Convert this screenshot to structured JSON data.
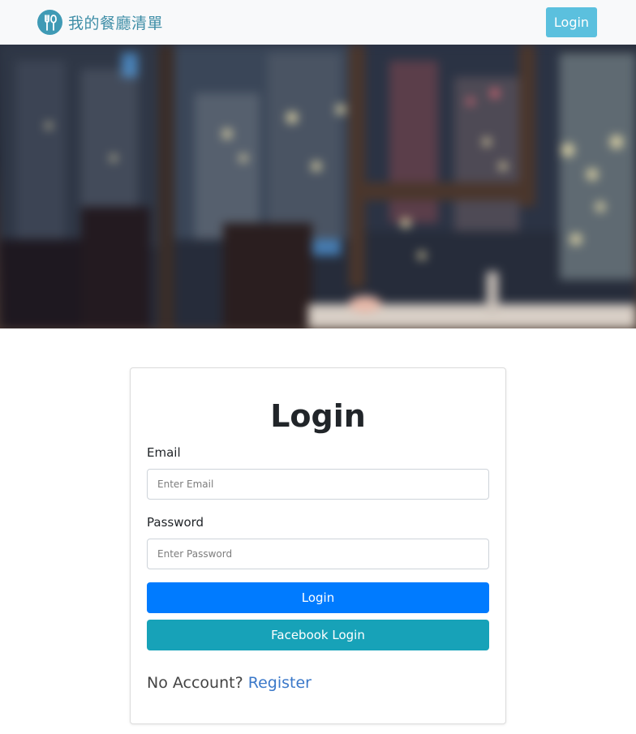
{
  "navbar": {
    "brand_icon": "fork-knife-icon",
    "brand_name": "我的餐廳清單",
    "login_label": "Login"
  },
  "hero": {
    "image_description_icon": "blurred-city-restaurant-image"
  },
  "login_form": {
    "title": "Login",
    "email_label": "Email",
    "email_placeholder": "Enter Email",
    "email_value": "",
    "password_label": "Password",
    "password_placeholder": "Enter Password",
    "password_value": "",
    "login_button": "Login",
    "facebook_button": "Facebook Login",
    "no_account_text": "No Account?",
    "register_link": "Register"
  },
  "colors": {
    "navbar_bg": "#f8f9fa",
    "brand": "#3f9ab5",
    "nav_login_bg": "#5bc0de",
    "primary": "#007bff",
    "facebook": "#17a2b8",
    "link": "#3a78c9"
  }
}
